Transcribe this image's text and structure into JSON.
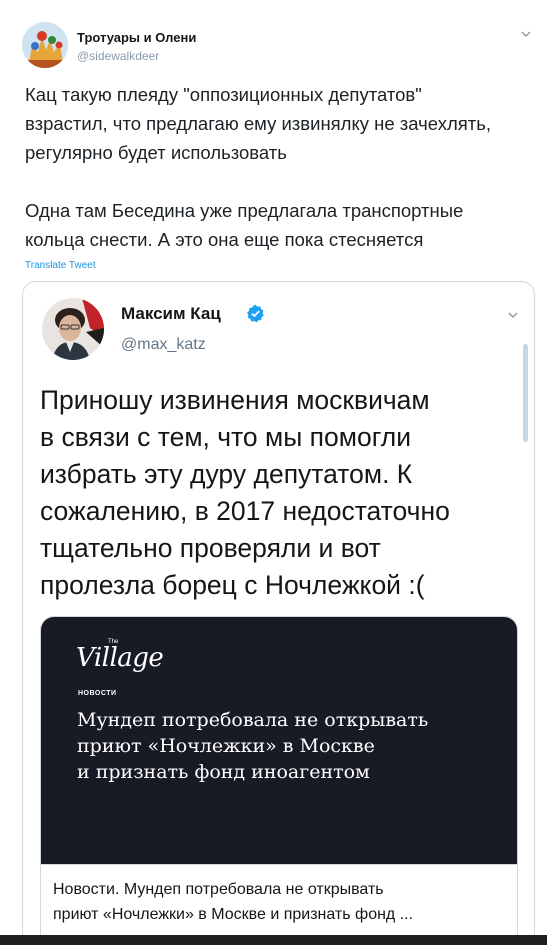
{
  "tweet": {
    "author_name": "Тротуары и Олени",
    "author_handle": "@sidewalkdeer",
    "text_lines": [
      "Кац такую плеяду \"оппозиционных депутатов\"",
      "взрастил, что предлагаю ему извинялку не зачехлять,",
      "регулярно будет использовать",
      "",
      "Одна там Беседина уже предлагала транспортные",
      "кольца снести. А это она еще пока стесняется"
    ],
    "translate_label": "Translate Tweet",
    "menu_icon": "chevron-down-icon"
  },
  "quoted_tweet": {
    "author_name": "Максим Кац",
    "author_handle": "@max_katz",
    "verified_icon": "verified-badge-icon",
    "text_lines": [
      "Приношу извинения москвичам",
      "в связи с тем, что мы помогли",
      "избрать эту дуру депутатом. К",
      "сожалению, в 2017 недостаточно",
      "тщательно проверяли и вот",
      "пролезла борец с Ночлежкой :("
    ],
    "card": {
      "logo": "Village",
      "logo_superscript": "The",
      "section_label": "НОВОСТИ",
      "headline_lines": [
        "Мундеп потребовала не открывать",
        "приют «Ночлежки» в Москве",
        "и признать фонд иноагентом"
      ],
      "title_lines": [
        "Новости. Мундеп потребовала не открывать",
        "приют «Ночлежки» в Москве и признать фонд ..."
      ]
    }
  },
  "colors": {
    "link": "#1b95e0",
    "verified": "#1da1f2",
    "card_background": "#181b25",
    "border": "#cfd9de"
  }
}
